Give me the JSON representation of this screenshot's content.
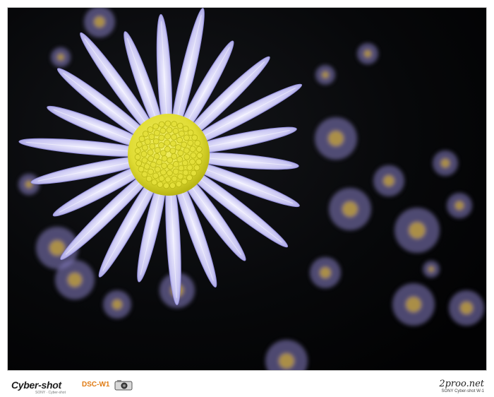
{
  "photo": {
    "subject": "daisy-photo",
    "colors": {
      "background": "#050607",
      "petal": "#c9c6f2",
      "petal_shadow": "#8d88d8",
      "center": "#e4e03a",
      "center_dark": "#b7b413",
      "bokeh_flower": "#8a82c9"
    }
  },
  "footer": {
    "brand": "Cyber-shot",
    "brand_sub": "SONY · Cyber-shot",
    "model": "DSC-W1",
    "camera_icon": "camera-icon",
    "site": "2proo.net",
    "site_sub": "SONY Cyber-shot W-1"
  }
}
